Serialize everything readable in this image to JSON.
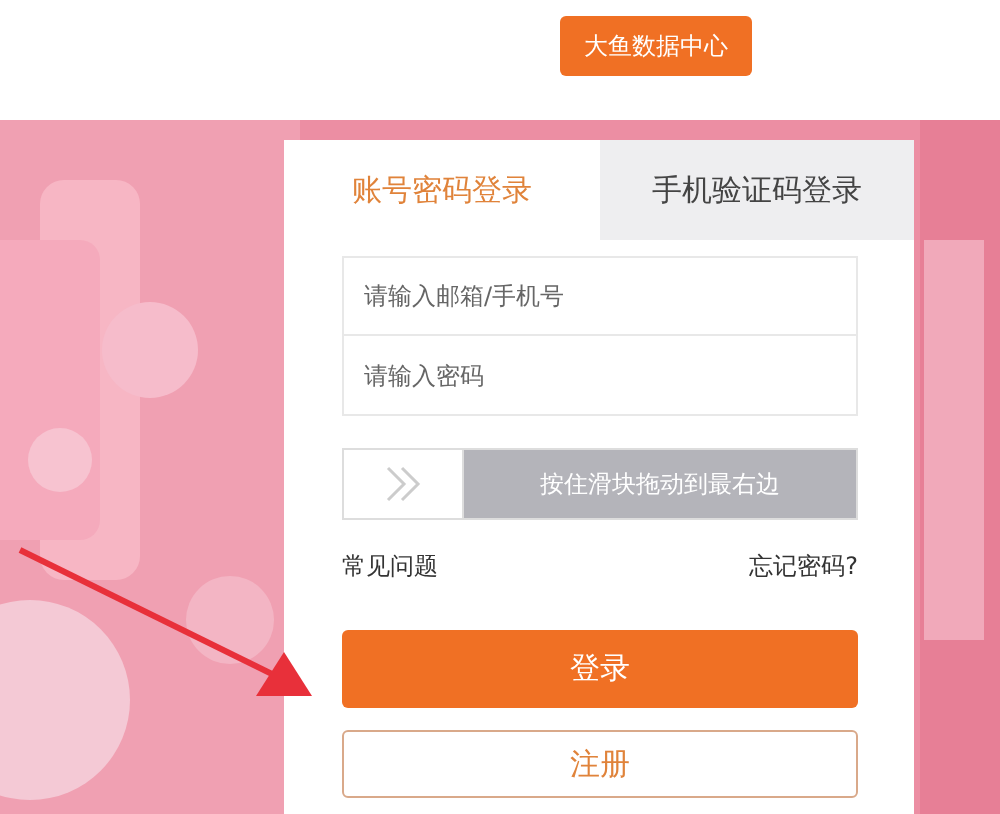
{
  "header": {
    "button": "大鱼数据中心"
  },
  "login": {
    "tabs": [
      {
        "label": "账号密码登录",
        "selected": true
      },
      {
        "label": "手机验证码登录",
        "selected": false
      }
    ],
    "fields": [
      {
        "placeholder": "请输入邮箱/手机号"
      },
      {
        "placeholder": "请输入密码"
      }
    ],
    "slider": {
      "hint": "按住滑块拖动到最右边",
      "level": 0
    },
    "links": [
      "常见问题",
      "忘记密码?"
    ],
    "buttons": [
      {
        "label": "登录",
        "kind": "primary"
      },
      {
        "label": "注册",
        "kind": "outline"
      }
    ]
  }
}
